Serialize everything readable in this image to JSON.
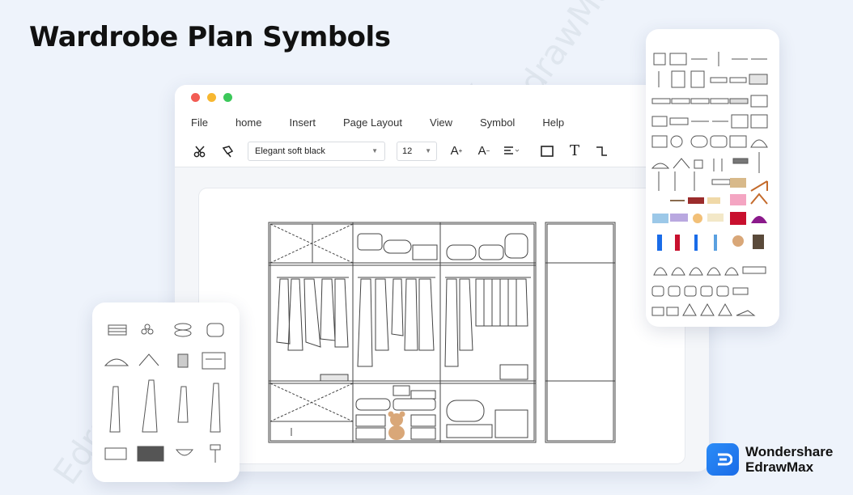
{
  "headline": "Wardrobe Plan Symbols",
  "window": {
    "dots": [
      "#f25c54",
      "#f7b731",
      "#3cc85a"
    ],
    "menu": [
      "File",
      "home",
      "Insert",
      "Page Layout",
      "View",
      "Symbol",
      "Help"
    ],
    "toolbar": {
      "font_name": "Elegant soft black",
      "font_size": "12",
      "icons": [
        "scissors-icon",
        "format-painter-icon",
        "font-grow-icon",
        "font-shrink-icon",
        "align-icon",
        "rectangle-icon",
        "text-icon",
        "connector-icon"
      ]
    }
  },
  "watermark_text": "EdrawMax",
  "brand": {
    "line1": "Wondershare",
    "line2": "EdrawMax"
  }
}
